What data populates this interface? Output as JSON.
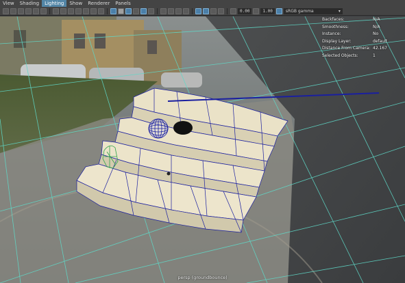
{
  "menu": {
    "items": [
      {
        "label": "View"
      },
      {
        "label": "Shading"
      },
      {
        "label": "Lighting",
        "active": true
      },
      {
        "label": "Show"
      },
      {
        "label": "Renderer"
      },
      {
        "label": "Panels"
      }
    ]
  },
  "toolbar": {
    "exposure_value": "0.00",
    "gamma_value": "1.00",
    "color_space": "sRGB gamma"
  },
  "hud": {
    "rows": [
      {
        "label": "Backfaces:",
        "value": "N/A"
      },
      {
        "label": "Smoothness:",
        "value": "N/A"
      },
      {
        "label": "Instance:",
        "value": "No"
      },
      {
        "label": "Display Layer:",
        "value": "default"
      },
      {
        "label": "Distance From Camera:",
        "value": "42.167"
      },
      {
        "label": "Selected Objects:",
        "value": "1"
      }
    ]
  },
  "viewport": {
    "camera_label": "persp (groundbounce)"
  },
  "colors": {
    "ui_bg": "#444444",
    "active_menu": "#5285a6",
    "grid": "#5fd9c8",
    "wire": "#1a1fa0",
    "mesh": "#e9e1c8"
  }
}
